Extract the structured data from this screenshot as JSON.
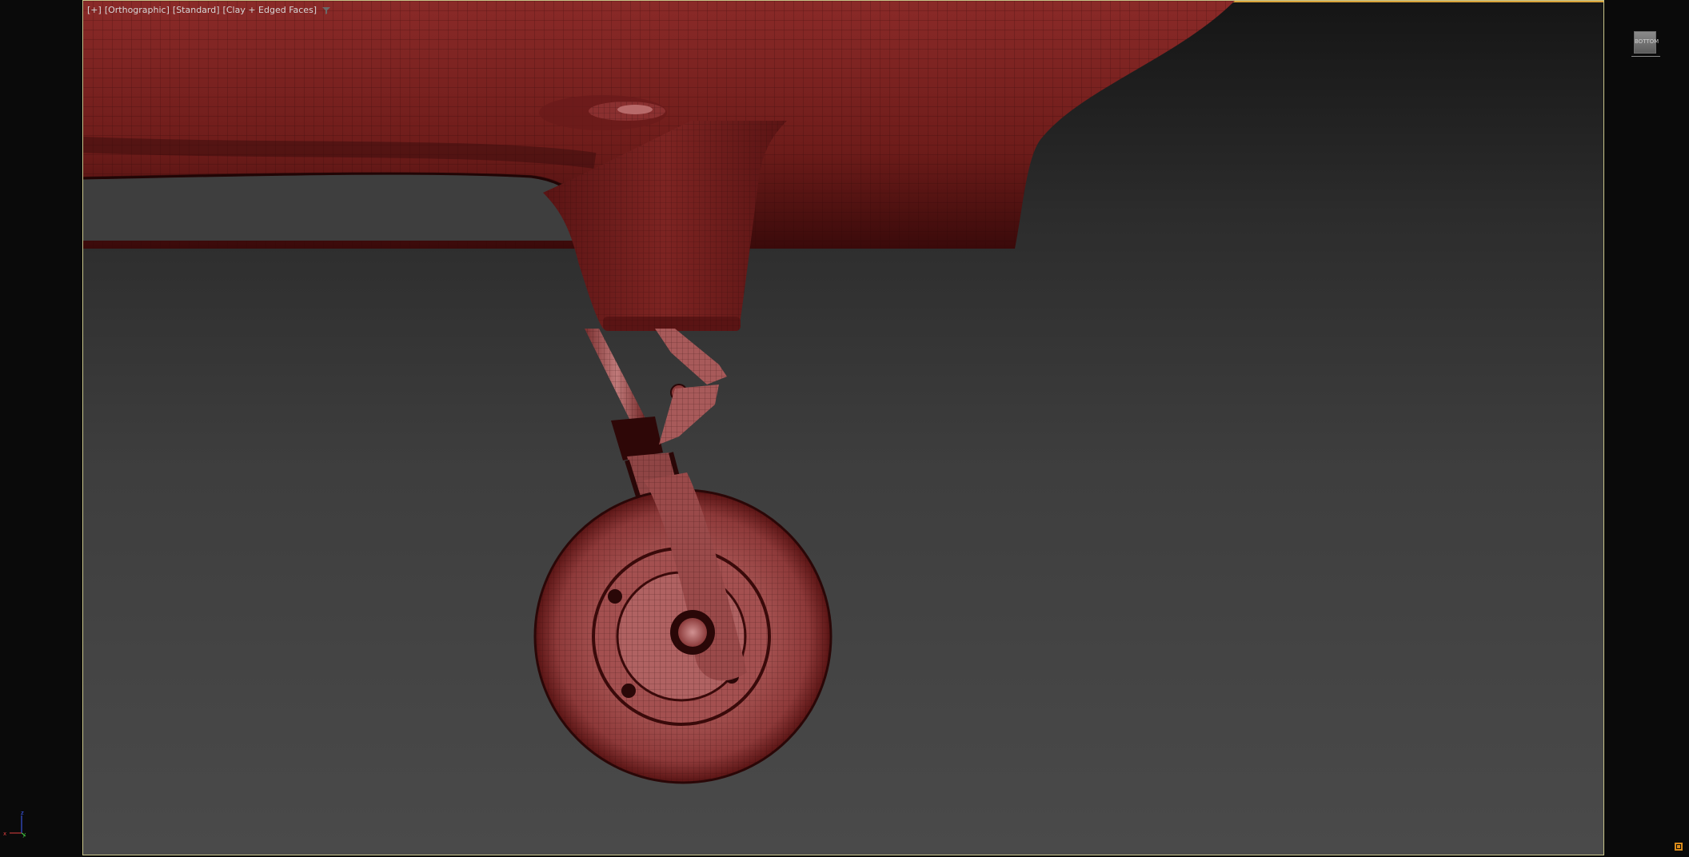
{
  "viewport": {
    "label": {
      "plus_menu": "[+]",
      "view_type": "[Orthographic]",
      "shading_mode": "[Standard]",
      "display_mode": "[Clay + Edged Faces]"
    },
    "border_color": "#c9c58a",
    "active_accent_color": "#d8a33a"
  },
  "model": {
    "color": "#7a2020",
    "wire_color": "#2a0808",
    "highlight_color": "#c98888"
  },
  "viewcube": {
    "face_label": "BOTTOM"
  },
  "axis_tripod": {
    "x_label": "x",
    "y_label": "y",
    "z_label": "z",
    "x_color": "#e04040",
    "y_color": "#40c040",
    "z_color": "#4060ff"
  },
  "icons": {
    "filter": "filter-icon",
    "corner": "viewport-config-icon"
  }
}
